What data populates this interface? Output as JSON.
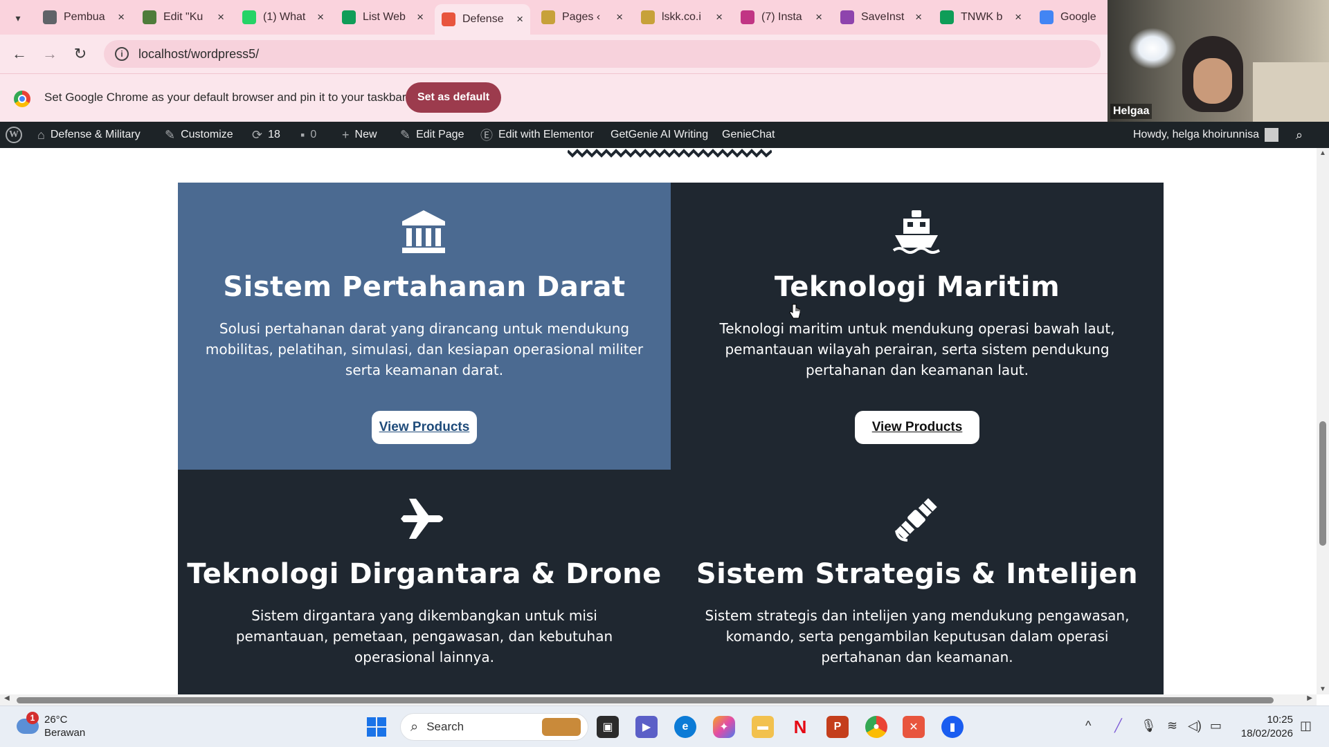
{
  "browser": {
    "tabs": [
      {
        "title": "Pembua",
        "favicon_color": "#5f6368",
        "active": false
      },
      {
        "title": "Edit \"Ku",
        "favicon_color": "#4e7c3a",
        "active": false
      },
      {
        "title": "(1) What",
        "favicon_color": "#25d366",
        "active": false
      },
      {
        "title": "List Web",
        "favicon_color": "#0f9d58",
        "active": false
      },
      {
        "title": "Defense",
        "favicon_color": "#e8553e",
        "active": true
      },
      {
        "title": "Pages ‹",
        "favicon_color": "#c7a13a",
        "active": false
      },
      {
        "title": "lskk.co.i",
        "favicon_color": "#c7a13a",
        "active": false
      },
      {
        "title": "(7) Insta",
        "favicon_color": "#c13584",
        "active": false
      },
      {
        "title": "SaveInst",
        "favicon_color": "#8e44ad",
        "active": false
      },
      {
        "title": "TNWK b",
        "favicon_color": "#0f9d58",
        "active": false
      },
      {
        "title": "Google",
        "favicon_color": "#4285f4",
        "active": false
      }
    ],
    "url": "localhost/wordpress5/",
    "banner_message": "Set Google Chrome as your default browser and pin it to your taskbar",
    "banner_button": "Set as default"
  },
  "webcam": {
    "name": "Helgaa"
  },
  "wp_admin_bar": {
    "site_name": "Defense & Military",
    "customize": "Customize",
    "updates_count": "18",
    "comments_count": "0",
    "new": "New",
    "edit_page": "Edit Page",
    "edit_elementor": "Edit with Elementor",
    "getgenie": "GetGenie AI Writing",
    "geniechat": "GenieChat",
    "howdy": "Howdy, helga khoirunnisa"
  },
  "cards": [
    {
      "title": "Sistem Pertahanan Darat",
      "description": "Solusi pertahanan darat yang dirancang untuk mendukung mobilitas, pelatihan, simulasi, dan kesiapan operasional militer serta keamanan darat.",
      "button": "View Products",
      "icon": "landmark-icon",
      "bg": "#4b6a91"
    },
    {
      "title": "Teknologi Maritim",
      "description": "Teknologi maritim untuk mendukung operasi bawah laut, pemantauan wilayah perairan, serta sistem pendukung pertahanan dan keamanan laut.",
      "button": "View Products",
      "icon": "ship-icon",
      "bg": "#1f2730"
    },
    {
      "title": "Teknologi Dirgantara & Drone",
      "description": "Sistem dirgantara yang dikembangkan untuk misi pemantauan, pemetaan, pengawasan, dan kebutuhan operasional lainnya.",
      "icon": "plane-icon",
      "bg": "#1f2730"
    },
    {
      "title": "Sistem Strategis & Intelijen",
      "description": "Sistem strategis dan intelijen yang mendukung pengawasan, komando, serta pengambilan keputusan dalam operasi pertahanan dan keamanan.",
      "icon": "satellite-icon",
      "bg": "#1f2730"
    }
  ],
  "taskbar": {
    "weather_temp": "26°C",
    "weather_desc": "Berawan",
    "weather_badge": "1",
    "search_label": "Search",
    "time": "10:25",
    "date": "18/02/2026"
  }
}
